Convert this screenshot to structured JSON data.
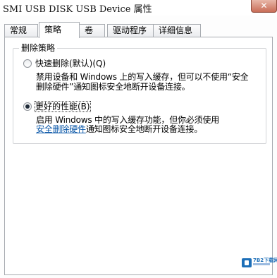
{
  "window": {
    "title": "SMI USB DISK USB Device 属性",
    "close_label": "✕"
  },
  "tabs": [
    {
      "label": "常规"
    },
    {
      "label": "策略"
    },
    {
      "label": "卷"
    },
    {
      "label": "驱动程序"
    },
    {
      "label": "详细信息"
    }
  ],
  "active_tab": "策略",
  "group": {
    "label": "删除策略",
    "options": [
      {
        "label": "快速删除(默认)(Q)",
        "selected": false,
        "description_lines": [
          "禁用设备和 Windows 上的写入缓存，但可以不使用“安全",
          "删除硬件”通知图标安全地断开设备连接。"
        ]
      },
      {
        "label": "更好的性能(B)",
        "selected": true,
        "description_line1": "启用 Windows 中的写入缓存功能，但你必须使用",
        "link_text": "安全删除硬件",
        "description_line2_rest": "通知图标安全地断开设备连接。"
      }
    ]
  },
  "watermark": {
    "text": "7B2下载网"
  }
}
